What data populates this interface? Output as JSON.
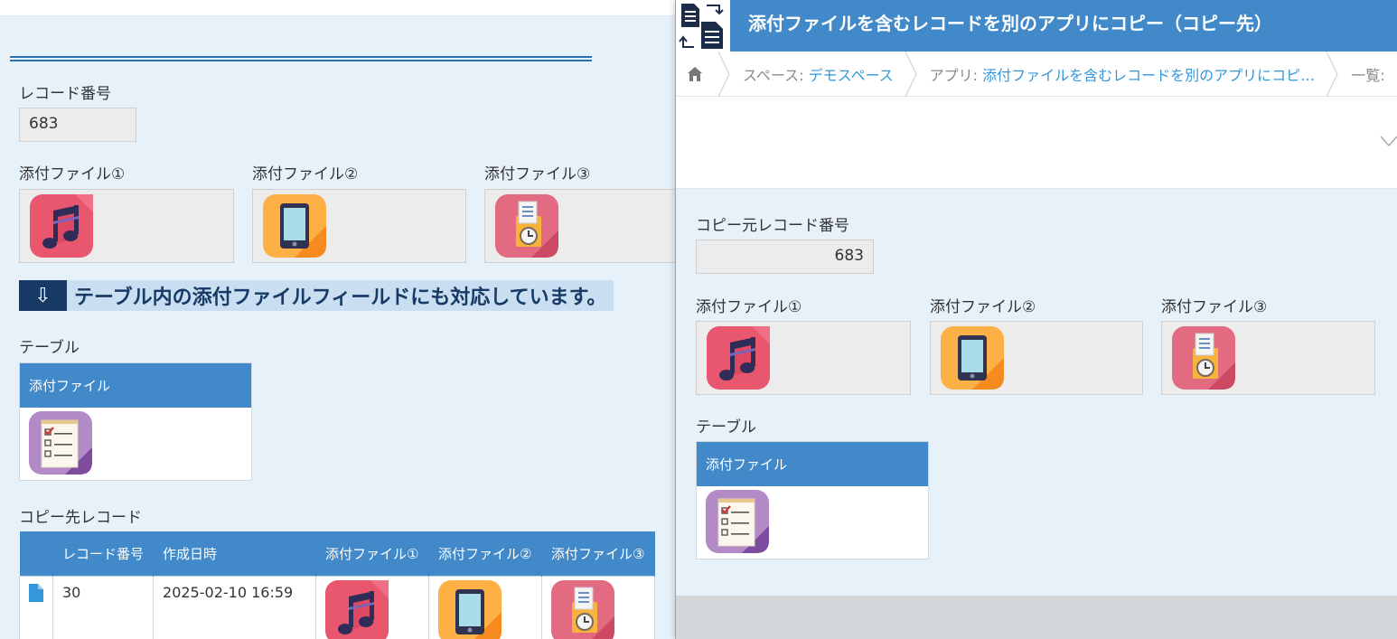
{
  "left": {
    "record_no_label": "レコード番号",
    "record_no_value": "683",
    "attachments": [
      {
        "label": "添付ファイル①",
        "icon": "music-icon"
      },
      {
        "label": "添付ファイル②",
        "icon": "tablet-icon"
      },
      {
        "label": "添付ファイル③",
        "icon": "timecard-icon"
      }
    ],
    "banner_arrow": "⇩",
    "banner_text": "テーブル内の添付ファイルフィールドにも対応しています。",
    "table_label": "テーブル",
    "table_header": "添付ファイル",
    "table_row_icon": "checklist-icon",
    "related_label": "コピー先レコード",
    "related_columns": [
      "",
      "レコード番号",
      "作成日時",
      "添付ファイル①",
      "添付ファイル②",
      "添付ファイル③"
    ],
    "related_rows": [
      {
        "icon": "document-icon",
        "record_no": "30",
        "created": "2025-02-10 16:59",
        "files": [
          "music-icon",
          "tablet-icon",
          "timecard-icon"
        ]
      }
    ]
  },
  "right": {
    "title": "添付ファイルを含むレコードを別のアプリにコピー（コピー先）",
    "breadcrumb": {
      "home_icon": "home-icon",
      "space_prefix": "スペース: ",
      "space_link": "デモスペース",
      "app_prefix": "アプリ: ",
      "app_link": "添付ファイルを含むレコードを別のアプリにコピ…",
      "list_prefix": "一覧:"
    },
    "source_no_label": "コピー元レコード番号",
    "source_no_value": "683",
    "attachments": [
      {
        "label": "添付ファイル①",
        "icon": "music-icon"
      },
      {
        "label": "添付ファイル②",
        "icon": "tablet-icon"
      },
      {
        "label": "添付ファイル③",
        "icon": "timecard-icon"
      }
    ],
    "table_label": "テーブル",
    "table_header": "添付ファイル",
    "table_row_icon": "checklist-icon"
  },
  "colors": {
    "header_blue": "#4189c9",
    "banner_navy": "#173a66",
    "banner_bg": "#c9def0",
    "link": "#3498db",
    "page_bg": "#e7f1fa"
  }
}
